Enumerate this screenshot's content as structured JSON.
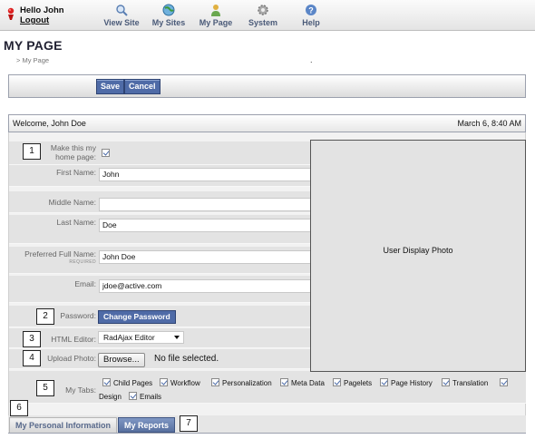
{
  "user": {
    "greeting": "Hello John",
    "logout": "Logout"
  },
  "nav": [
    {
      "label": "View Site",
      "icon": "magnifier-icon"
    },
    {
      "label": "My Sites",
      "icon": "globe-icon"
    },
    {
      "label": "My Page",
      "icon": "person-icon"
    },
    {
      "label": "System",
      "icon": "gear-icon"
    },
    {
      "label": "Help",
      "icon": "help-icon"
    }
  ],
  "page": {
    "title": "MY PAGE",
    "breadcrumb": "> My Page",
    "dot": "."
  },
  "toolbar": {
    "save": "Save",
    "cancel": "Cancel"
  },
  "welcome": {
    "text": "Welcome, John Doe",
    "datetime": "March 6, 8:40 AM"
  },
  "form": {
    "home_page_label_1": "Make this my",
    "home_page_label_2": "home page:",
    "home_page_checked": true,
    "first_name_label": "First Name:",
    "first_name": "John",
    "middle_name_label": "Middle Name:",
    "middle_name": "",
    "last_name_label": "Last Name:",
    "last_name": "Doe",
    "preferred_label": "Preferred Full Name:",
    "preferred_required": "REQUIRED",
    "preferred_name": "John Doe",
    "email_label": "Email:",
    "email": "jdoe@active.com",
    "password_label": "Password:",
    "change_password": "Change Password",
    "editor_label": "HTML Editor:",
    "editor_value": "RadAjax Editor",
    "photo_label": "Upload Photo:",
    "browse": "Browse...",
    "no_file": "No file selected.",
    "tabs_label": "My Tabs:",
    "tab_options": [
      "Child Pages",
      "Workflow",
      "Personalization",
      "Meta Data",
      "Pagelets",
      "Page History",
      "Translation",
      "Design",
      "Emails"
    ]
  },
  "photo": {
    "label": "User Display Photo"
  },
  "callouts": [
    "1",
    "2",
    "3",
    "4",
    "5",
    "6",
    "7"
  ],
  "bottom_tabs": {
    "personal": "My Personal Information",
    "reports": "My Reports"
  },
  "colors": {
    "button_blue": "#4f6ba7",
    "tab_active": "#58709f",
    "tab_inactive_text": "#596a8c"
  }
}
